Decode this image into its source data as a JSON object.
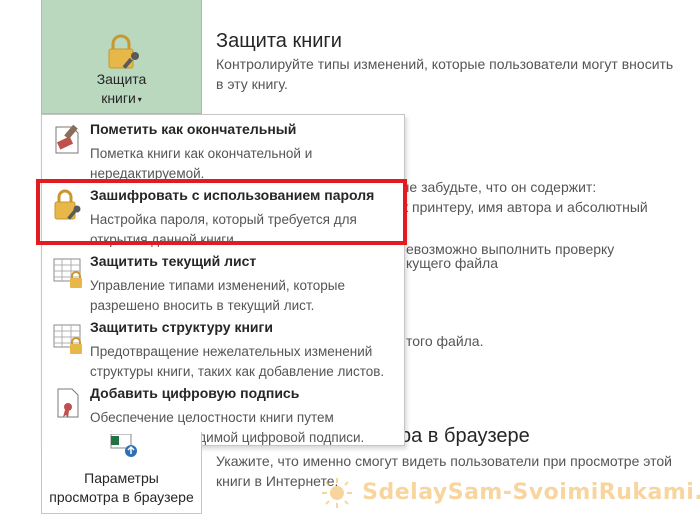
{
  "protect_button": {
    "label_line1": "Защита",
    "label_line2": "книги",
    "caret": "▾",
    "icon": "lock-key-icon"
  },
  "protect_section": {
    "title": "Защита книги",
    "desc_line1": "Контролируйте типы изменений, которые пользователи могут вносить",
    "desc_line2": "в эту книгу."
  },
  "background_text": {
    "line1": "а не забудьте, что он содержит:",
    "line2": "к принтеру, имя автора и абсолютный",
    "line3": "евозможно выполнить проверку",
    "line4": "кущего файла",
    "line5": "того файла.",
    "browser_title_fragment": "ра в браузере"
  },
  "menu": {
    "items": [
      {
        "title": "Пометить как окончательный",
        "desc_line1": "Пометка книги как окончательной и",
        "desc_line2": "нередактируемой.",
        "icon": "mark-final-icon"
      },
      {
        "title": "Зашифровать с использованием пароля",
        "desc_line1": "Настройка пароля, который требуется для",
        "desc_line2": "открытия данной книги.",
        "icon": "lock-key-icon"
      },
      {
        "title": "Защитить текущий лист",
        "desc_line1": "Управление типами изменений, которые",
        "desc_line2": "разрешено вносить в текущий лист.",
        "icon": "sheet-lock-icon"
      },
      {
        "title": "Защитить структуру книги",
        "desc_line1": "Предотвращение нежелательных изменений",
        "desc_line2": "структуры книги, таких как добавление листов.",
        "icon": "workbook-structure-lock-icon"
      },
      {
        "title": "Добавить цифровую подпись",
        "desc_line1": "Обеспечение целостности книги путем",
        "desc_line2": "добавления невидимой цифровой подписи.",
        "icon": "digital-signature-icon"
      }
    ]
  },
  "browser_button": {
    "label_line1": "Параметры",
    "label_line2": "просмотра в браузере",
    "icon": "browser-view-icon"
  },
  "browser_section": {
    "desc_line1": "Укажите, что именно смогут видеть пользователи при просмотре этой",
    "desc_line2": "книги в Интернете."
  },
  "watermark": {
    "text": "SdelaySam-SvoimiRukami.ru"
  },
  "colors": {
    "protect_button_bg": "#b9d8be",
    "highlight_border": "#e21b23",
    "lock_gold": "#e8b74a",
    "watermark": "#f2b34e"
  }
}
